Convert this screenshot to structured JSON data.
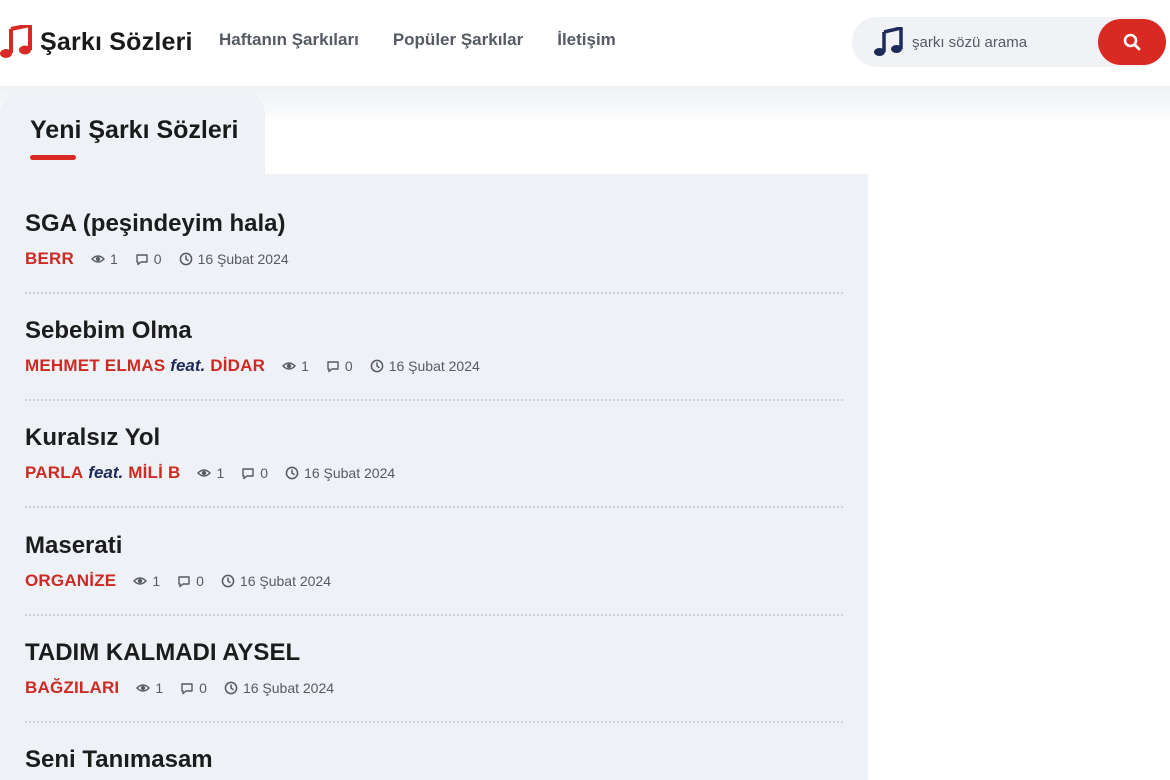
{
  "site": {
    "logo_text": "Şarkı Sözleri",
    "brand_color": "#d82a22",
    "nav": [
      "Haftanın Şarkıları",
      "Popüler Şarkılar",
      "İletişim"
    ],
    "search_placeholder": "şarkı sözü arama"
  },
  "section": {
    "title": "Yeni Şarkı Sözleri"
  },
  "songs": [
    {
      "title": "SGA (peşindeyim hala)",
      "artists": [
        "BERR"
      ],
      "views": "1",
      "comments": "0",
      "date": "16 Şubat 2024"
    },
    {
      "title": "Sebebim Olma",
      "artists": [
        "MEHMET ELMAS",
        "DİDAR"
      ],
      "views": "1",
      "comments": "0",
      "date": "16 Şubat 2024"
    },
    {
      "title": "Kuralsız Yol",
      "artists": [
        "PARLA",
        "MİLİ B"
      ],
      "views": "1",
      "comments": "0",
      "date": "16 Şubat 2024"
    },
    {
      "title": "Maserati",
      "artists": [
        "ORGANİZE"
      ],
      "views": "1",
      "comments": "0",
      "date": "16 Şubat 2024"
    },
    {
      "title": "TADIM KALMADI AYSEL",
      "artists": [
        "BAĞZILARI"
      ],
      "views": "1",
      "comments": "0",
      "date": "16 Şubat 2024"
    },
    {
      "title": "Seni Tanımasam",
      "artists": [],
      "views": "",
      "comments": "",
      "date": ""
    }
  ],
  "labels": {
    "feat": "feat."
  },
  "icons": {
    "logo": "music-note-icon",
    "search_note": "music-note-icon",
    "search_button": "search-icon",
    "views": "eye-icon",
    "comments": "comment-icon",
    "date": "clock-icon"
  }
}
